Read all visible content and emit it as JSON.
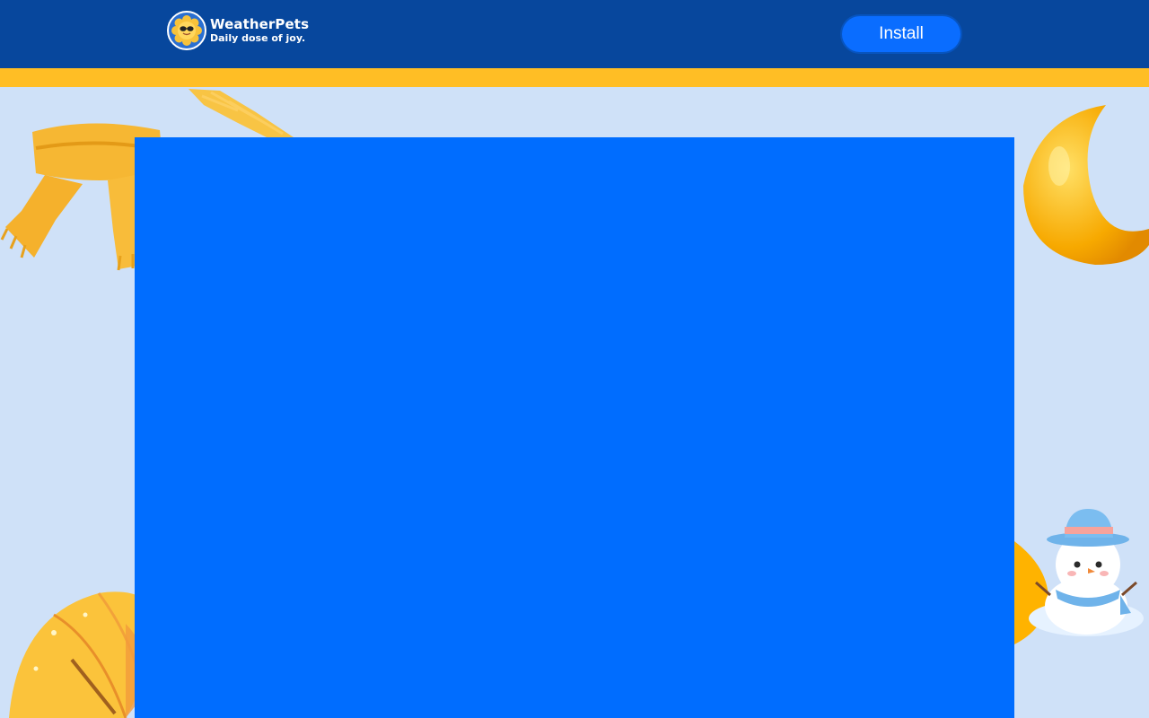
{
  "header": {
    "brand_name": "WeatherPets",
    "tagline": "Daily dose of joy.",
    "install_label": "Install",
    "logo_icon": "sunflower-pet-icon"
  },
  "colors": {
    "header_bg": "#07479d",
    "accent_strip": "#ffbe25",
    "page_bg": "#cfe1f8",
    "panel_bg": "#006dff",
    "button_bg": "#0a6dff"
  },
  "decorations": [
    "scarf-icon",
    "paint-stroke",
    "moon-icon",
    "umbrella-icon",
    "snowman-icon"
  ]
}
